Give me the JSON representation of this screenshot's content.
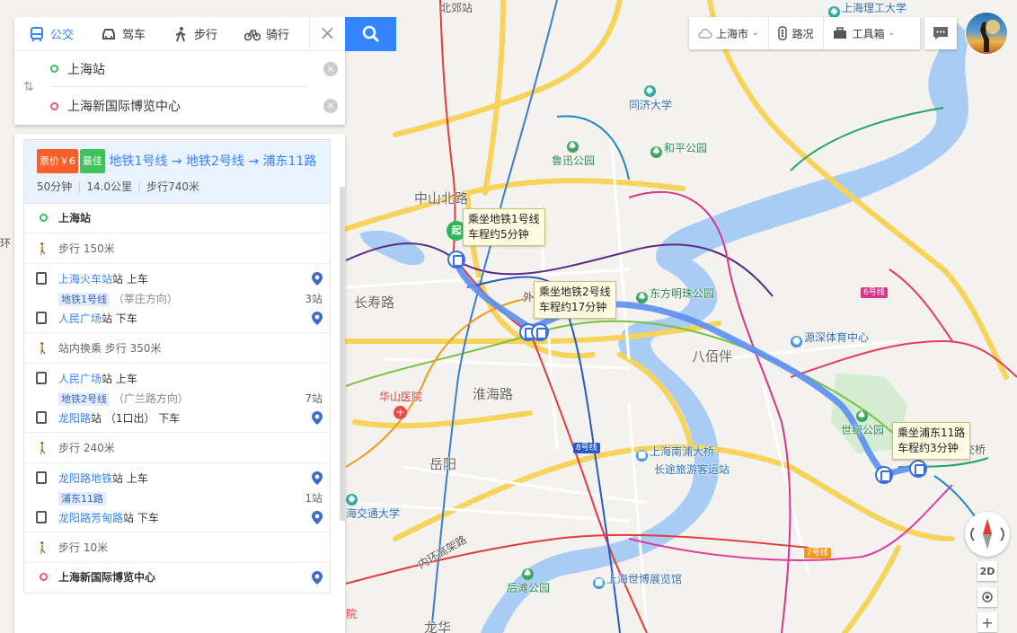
{
  "map": {
    "labels": {
      "beijiao": "北郊站",
      "shanghai_ligong": "上海理工大学",
      "tongji": "同济大学",
      "luxun_park": "鲁迅公园",
      "heping_park": "和平公园",
      "zhongshan_north": "中山北路",
      "changshou_road": "长寿路",
      "oriental_pearl": "东方明珠公园",
      "babaiban": "八佰伴",
      "yuanshen": "源深体育中心",
      "huashan": "华山医院",
      "huaihai": "淮海路",
      "shiji_park": "世纪公园",
      "yueyang": "岳阳",
      "nanpu_bridge": "上海南浦大桥",
      "long_distance": "长途旅游客运站",
      "jiaotong_univ": "海交通大学",
      "inner_ring": "内环高架路",
      "expo_center": "上海世博展览馆",
      "houtan_park": "后滩公园",
      "longhua": "龙华",
      "hospital": "院",
      "bridge_right": "交桥",
      "huan_left": "环",
      "wai": "外"
    },
    "line_tags": {
      "line6": "6号线",
      "line8": "8号线",
      "line7": "7号线"
    },
    "start_badge": "起",
    "callouts": {
      "c1_line1": "乘坐地铁1号线",
      "c1_line2": "车程约5分钟",
      "c2_line1": "乘坐地铁2号线",
      "c2_line2": "车程约17分钟",
      "c3_line1": "乘坐浦东11路",
      "c3_line2": "车程约3分钟"
    },
    "colors": {
      "route": "#5b8ff0",
      "river": "#a9ccf5",
      "road_yellow": "#f8d35a",
      "green_area": "#d5ecd0"
    }
  },
  "search": {
    "tabs": [
      {
        "label": "公交",
        "icon": "bus-icon"
      },
      {
        "label": "驾车",
        "icon": "car-icon"
      },
      {
        "label": "步行",
        "icon": "walk-icon"
      },
      {
        "label": "骑行",
        "icon": "bike-icon"
      }
    ],
    "from": "上海站",
    "to": "上海新国际博览中心"
  },
  "controls": {
    "city": "上海市",
    "traffic": "路况",
    "toolbox": "工具箱",
    "btn_2d": "2D",
    "plus": "+"
  },
  "result": {
    "price_badge": "票价￥6",
    "best_badge": "最佳",
    "title": "地铁1号线 → 地铁2号线 → 浦东11路",
    "duration": "50分钟",
    "distance": "14.0公里",
    "walk": "步行740米",
    "steps": {
      "start": "上海站",
      "walk1": "步行  150米",
      "board1_station": "上海火车站",
      "board1_suffix": "站  上车",
      "line1_name": "地铁1号线",
      "line1_dir": "（莘庄方向）",
      "line1_stops": "3站",
      "alight1_station": "人民广场",
      "alight1_suffix": "站  下车",
      "transfer": "站内换乘  步行  350米",
      "board2_station": "人民广场",
      "board2_suffix": "站  上车",
      "line2_name": "地铁2号线",
      "line2_dir": "（广兰路方向）",
      "line2_stops": "7站",
      "alight2_station": "龙阳路",
      "alight2_suffix": "站  （1口出）  下车",
      "walk2": "步行  240米",
      "board3_station": "龙阳路地铁",
      "board3_suffix": "站  上车",
      "line3_name": "浦东11路",
      "line3_stops": "1站",
      "alight3_station": "龙阳路芳甸路",
      "alight3_suffix": "站  下车",
      "walk3": "步行  10米",
      "end": "上海新国际博览中心"
    }
  }
}
